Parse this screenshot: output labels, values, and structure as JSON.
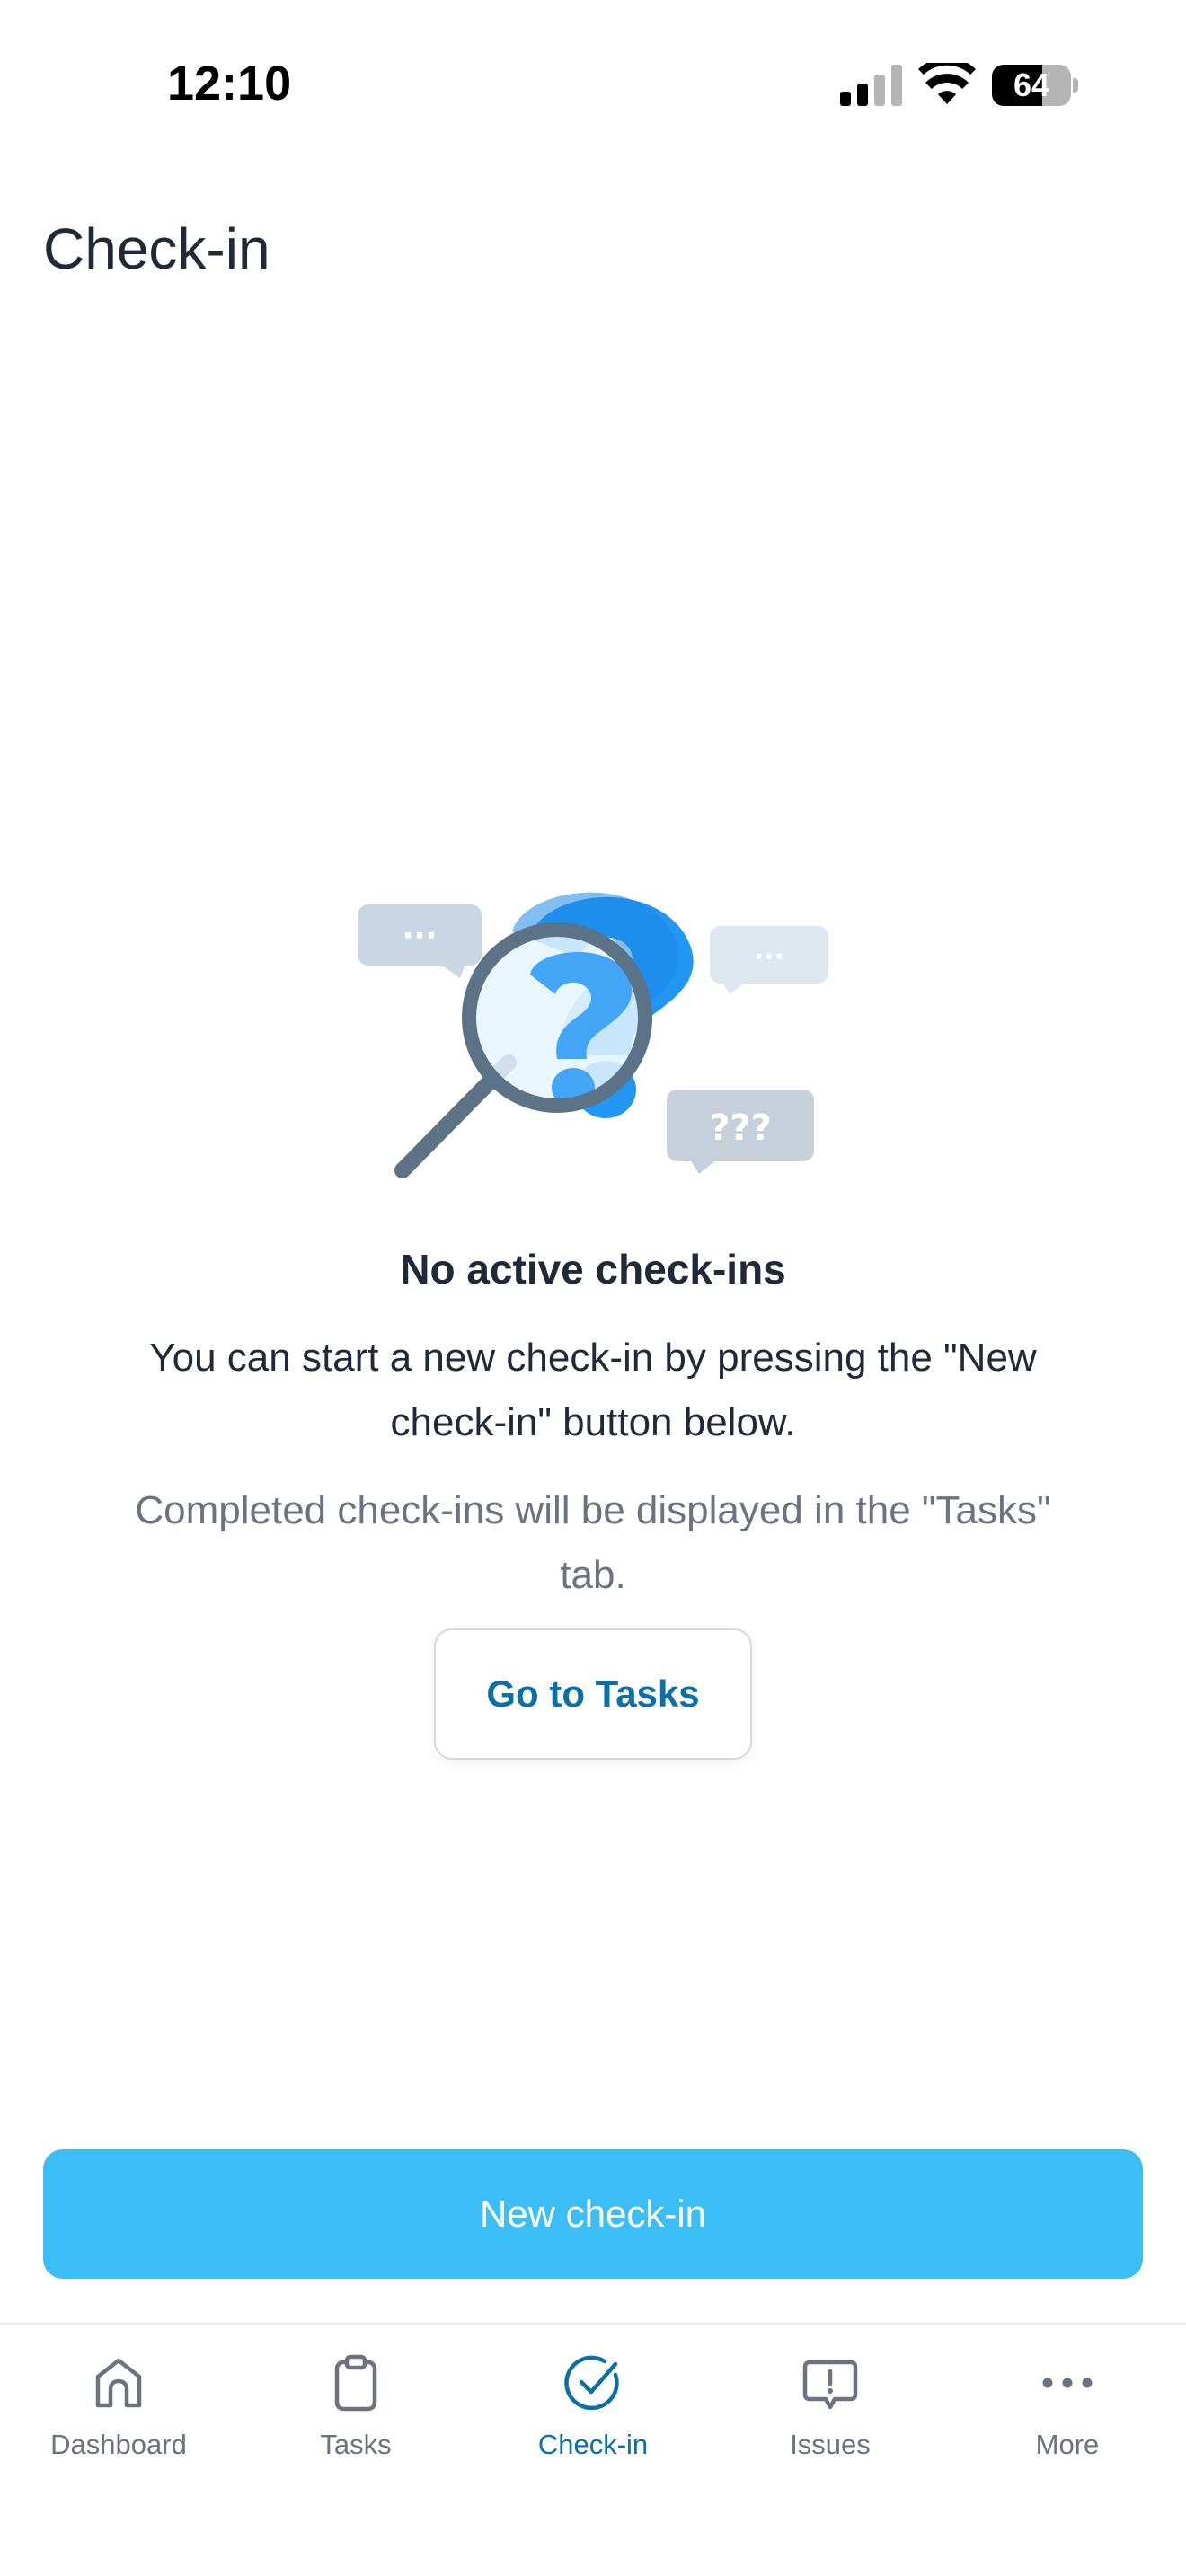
{
  "status_bar": {
    "time": "12:10",
    "battery_level": "64",
    "battery_fraction": 0.64,
    "icons": [
      "signal-icon",
      "wifi-icon",
      "battery-icon"
    ]
  },
  "header": {
    "title": "Check-in"
  },
  "empty_state": {
    "illustration": "magnifying-glass-question-illustration",
    "bubble_dots": "···",
    "bubble_question": "???",
    "title": "No active check-ins",
    "description": "You can start a new check-in by pressing the \"New check-in\" button below.",
    "note": "Completed check-ins will be displayed in the \"Tasks\" tab.",
    "go_to_tasks_label": "Go to Tasks"
  },
  "primary_action": {
    "label": "New check-in"
  },
  "tab_bar": {
    "active": "Check-in",
    "items": [
      {
        "label": "Dashboard",
        "icon": "home-icon"
      },
      {
        "label": "Tasks",
        "icon": "clipboard-icon"
      },
      {
        "label": "Check-in",
        "icon": "check-circle-icon"
      },
      {
        "label": "Issues",
        "icon": "alert-message-icon"
      },
      {
        "label": "More",
        "icon": "more-dots-icon"
      }
    ]
  },
  "colors": {
    "accent": "#0b6fa8",
    "primary_button": "#3bbef6",
    "text_primary": "#1f2937",
    "text_secondary": "#6b7280",
    "question_mark_blue": "#2196f3"
  }
}
